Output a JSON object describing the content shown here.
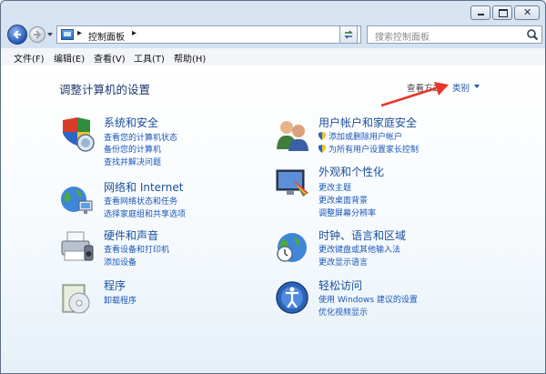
{
  "window": {
    "minimize_icon": "minimize-icon",
    "maximize_icon": "maximize-icon",
    "close_icon": "close-icon",
    "close_glyph": "✕"
  },
  "nav": {
    "address_path": "控制面板",
    "chevron": "▸",
    "search_placeholder": "搜索控制面板"
  },
  "menu": [
    "文件(F)",
    "编辑(E)",
    "查看(V)",
    "工具(T)",
    "帮助(H)"
  ],
  "main": {
    "title": "调整计算机的设置",
    "view_by_label": "查看方式:",
    "view_by_value": "类别"
  },
  "categories": {
    "system": {
      "title": "系统和安全",
      "links": [
        "查看您的计算机状态",
        "备份您的计算机",
        "查找并解决问题"
      ]
    },
    "network": {
      "title": "网络和 Internet",
      "links": [
        "查看网络状态和任务",
        "选择家庭组和共享选项"
      ]
    },
    "hardware": {
      "title": "硬件和声音",
      "links": [
        "查看设备和打印机",
        "添加设备"
      ]
    },
    "programs": {
      "title": "程序",
      "links": [
        "卸载程序"
      ]
    },
    "users": {
      "title": "用户帐户和家庭安全",
      "links": [
        "添加或删除用户帐户",
        "为所有用户设置家长控制"
      ]
    },
    "appearance": {
      "title": "外观和个性化",
      "links": [
        "更改主题",
        "更改桌面背景",
        "调整屏幕分辨率"
      ]
    },
    "clock": {
      "title": "时钟、语言和区域",
      "links": [
        "更改键盘或其他输入法",
        "更改显示语言"
      ]
    },
    "ease": {
      "title": "轻松访问",
      "links": [
        "使用 Windows 建议的设置",
        "优化视频显示"
      ]
    }
  },
  "colors": {
    "link": "#1a56b8",
    "heading": "#1a4f9c",
    "annotation_arrow": "#e8352a"
  }
}
